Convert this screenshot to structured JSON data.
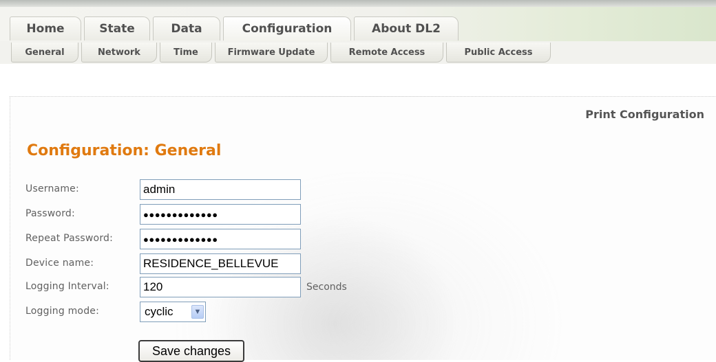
{
  "main_tabs": [
    {
      "label": "Home"
    },
    {
      "label": "State"
    },
    {
      "label": "Data"
    },
    {
      "label": "Configuration"
    },
    {
      "label": "About DL2"
    }
  ],
  "sub_tabs": [
    {
      "label": "General"
    },
    {
      "label": "Network"
    },
    {
      "label": "Time"
    },
    {
      "label": "Firmware Update"
    },
    {
      "label": "Remote Access"
    },
    {
      "label": "Public Access"
    }
  ],
  "print_link": "Print Configuration",
  "page_title": "Configuration: General",
  "form": {
    "username": {
      "label": "Username:",
      "value": "admin"
    },
    "password": {
      "label": "Password:",
      "value": "●●●●●●●●●●●●●"
    },
    "repeat_password": {
      "label": "Repeat Password:",
      "value": "●●●●●●●●●●●●●"
    },
    "device_name": {
      "label": "Device name:",
      "value": "RESIDENCE_BELLEVUE"
    },
    "logging_interval": {
      "label": "Logging Interval:",
      "value": "120",
      "unit": "Seconds"
    },
    "logging_mode": {
      "label": "Logging mode:",
      "value": "cyclic"
    }
  },
  "save_button": "Save changes",
  "colors": {
    "title": "#e07a10",
    "text": "#606060"
  }
}
